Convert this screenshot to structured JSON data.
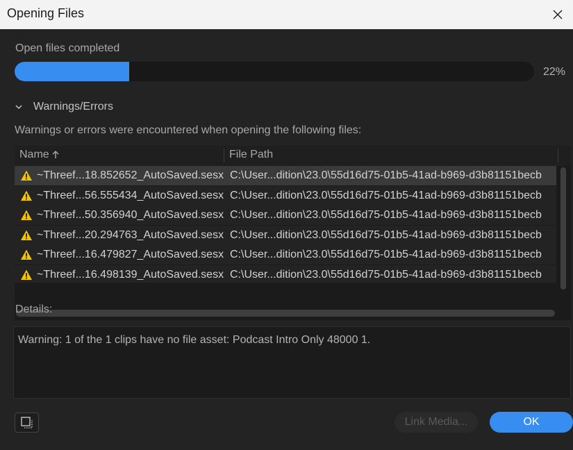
{
  "window": {
    "title": "Opening Files"
  },
  "progress": {
    "label": "Open files completed",
    "percent": 22,
    "percent_text": "22%"
  },
  "section": {
    "label": "Warnings/Errors",
    "expanded": true
  },
  "message": "Warnings or errors were encountered when opening the following files:",
  "table": {
    "columns": {
      "name": "Name",
      "path": "File Path"
    },
    "sort_icon": "arrow-up-icon",
    "rows": [
      {
        "name": "~Threef...18.852652_AutoSaved.sesx",
        "path": "C:\\User...dition\\23.0\\55d16d75-01b5-41ad-b969-d3b81151becb",
        "selected": true
      },
      {
        "name": "~Threef...56.555434_AutoSaved.sesx",
        "path": "C:\\User...dition\\23.0\\55d16d75-01b5-41ad-b969-d3b81151becb"
      },
      {
        "name": "~Threef...50.356940_AutoSaved.sesx",
        "path": "C:\\User...dition\\23.0\\55d16d75-01b5-41ad-b969-d3b81151becb"
      },
      {
        "name": "~Threef...20.294763_AutoSaved.sesx",
        "path": "C:\\User...dition\\23.0\\55d16d75-01b5-41ad-b969-d3b81151becb"
      },
      {
        "name": "~Threef...16.479827_AutoSaved.sesx",
        "path": "C:\\User...dition\\23.0\\55d16d75-01b5-41ad-b969-d3b81151becb"
      },
      {
        "name": "~Threef...16.498139_AutoSaved.sesx",
        "path": "C:\\User...dition\\23.0\\55d16d75-01b5-41ad-b969-d3b81151becb"
      }
    ]
  },
  "details": {
    "label": "Details:",
    "text": "Warning: 1 of the 1 clips have no file asset: Podcast Intro Only 48000 1."
  },
  "buttons": {
    "link_media": "Link Media...",
    "ok": "OK"
  },
  "colors": {
    "accent": "#378ef0",
    "warning": "#f3c300",
    "background": "#232323"
  }
}
